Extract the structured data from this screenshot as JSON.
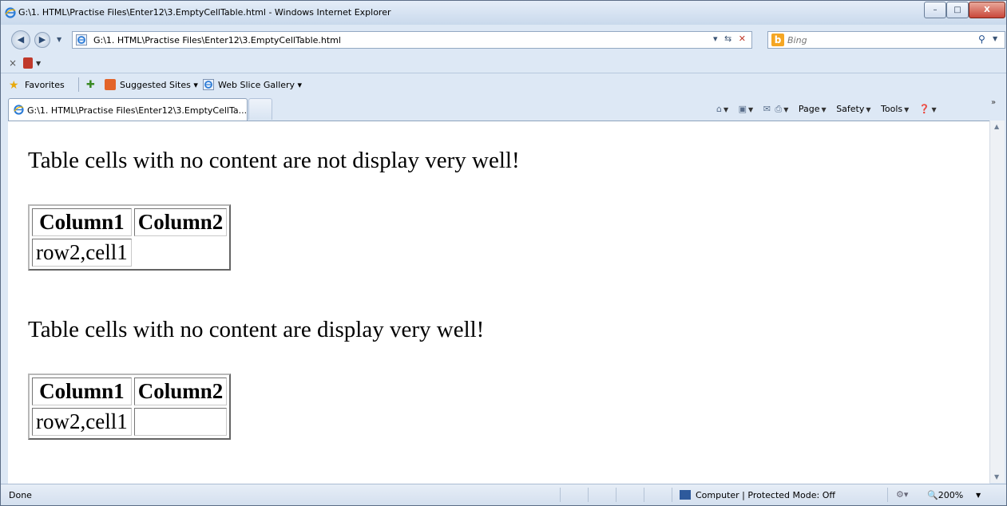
{
  "window": {
    "title": "G:\\1. HTML\\Practise Files\\Enter12\\3.EmptyCellTable.html - Windows Internet Explorer",
    "min_glyph": "–",
    "max_glyph": "□",
    "close_glyph": "X"
  },
  "nav": {
    "address": "G:\\1. HTML\\Practise Files\\Enter12\\3.EmptyCellTable.html",
    "search_placeholder": "Bing",
    "bing_logo": "b"
  },
  "favorites": {
    "label": "Favorites",
    "items": [
      {
        "label": "Suggested Sites ▾"
      },
      {
        "label": "Web Slice Gallery ▾"
      }
    ]
  },
  "tab": {
    "label": "G:\\1. HTML\\Practise Files\\Enter12\\3.EmptyCellTa..."
  },
  "command_bar": {
    "page": "Page",
    "safety": "Safety",
    "tools": "Tools"
  },
  "content": {
    "paragraph1": "Table cells with no content are not display very well!",
    "paragraph2": "Table cells with no content are display very well!",
    "table1": {
      "headers": [
        "Column1",
        "Column2"
      ],
      "rows": [
        [
          "row2,cell1",
          ""
        ]
      ]
    },
    "table2": {
      "headers": [
        "Column1",
        "Column2"
      ],
      "rows": [
        [
          "row2,cell1",
          ""
        ]
      ]
    }
  },
  "status": {
    "text": "Done",
    "zone": "Computer | Protected Mode: Off",
    "zoom": "200%"
  },
  "colors": {
    "chrome": "#dde8f5",
    "close_button": "#c9473a",
    "page_background": "#ffffff"
  },
  "icons": [
    "ie-logo-icon",
    "back-icon",
    "forward-icon",
    "refresh-icon",
    "stop-icon",
    "search-icon",
    "favorites-star-icon",
    "add-favorite-icon",
    "home-icon",
    "feeds-icon",
    "mail-icon",
    "print-icon",
    "help-icon",
    "computer-zone-icon",
    "zoom-icon"
  ]
}
